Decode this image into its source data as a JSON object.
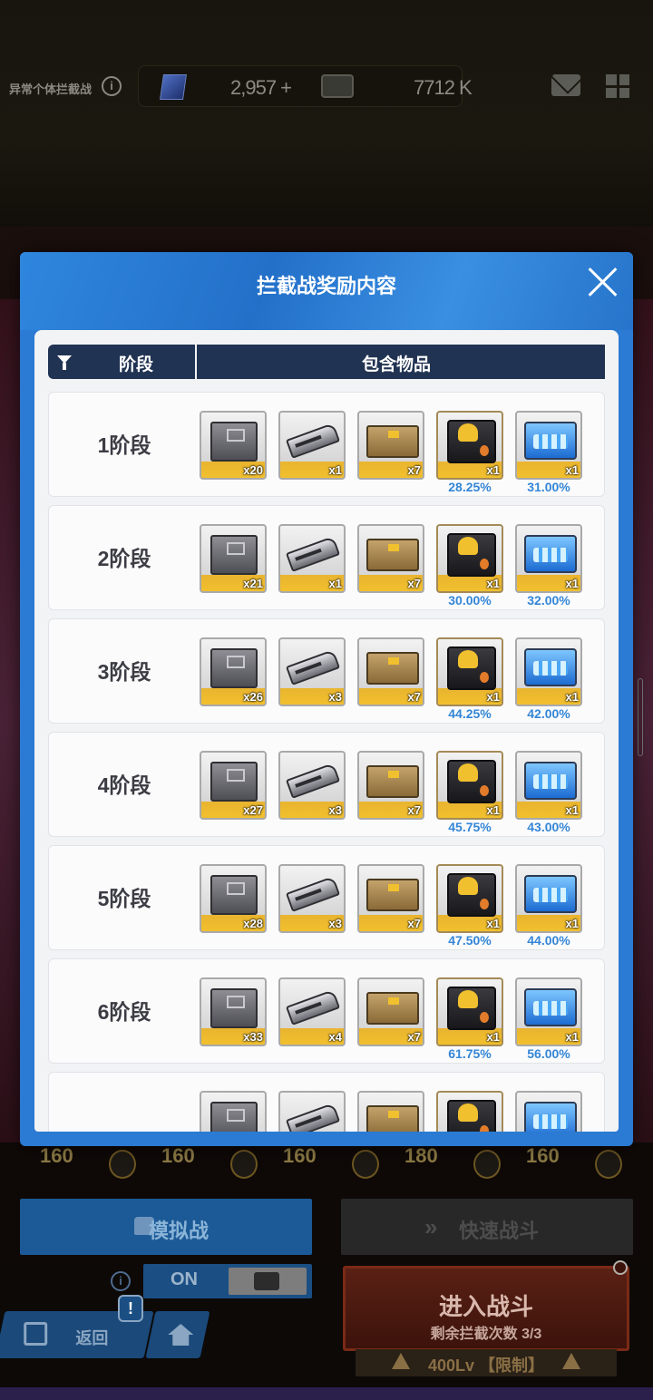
{
  "topbar": {
    "title": "异常个体拦截战",
    "info_icon": "info-icon",
    "currency1_value": "2,957 +",
    "currency2_value": "7712 K"
  },
  "modal": {
    "title": "拦截战奖励内容",
    "header_stage": "阶段",
    "header_items": "包含物品",
    "rows": [
      {
        "label": "1阶段",
        "counts": [
          "x20",
          "x1",
          "x7",
          "x1",
          "x1"
        ],
        "pct1": "28.25%",
        "pct2": "31.00%"
      },
      {
        "label": "2阶段",
        "counts": [
          "x21",
          "x1",
          "x7",
          "x1",
          "x1"
        ],
        "pct1": "30.00%",
        "pct2": "32.00%"
      },
      {
        "label": "3阶段",
        "counts": [
          "x26",
          "x3",
          "x7",
          "x1",
          "x1"
        ],
        "pct1": "44.25%",
        "pct2": "42.00%"
      },
      {
        "label": "4阶段",
        "counts": [
          "x27",
          "x3",
          "x7",
          "x1",
          "x1"
        ],
        "pct1": "45.75%",
        "pct2": "43.00%"
      },
      {
        "label": "5阶段",
        "counts": [
          "x28",
          "x3",
          "x7",
          "x1",
          "x1"
        ],
        "pct1": "47.50%",
        "pct2": "44.00%"
      },
      {
        "label": "6阶段",
        "counts": [
          "x33",
          "x4",
          "x7",
          "x1",
          "x1"
        ],
        "pct1": "61.75%",
        "pct2": "56.00%"
      }
    ]
  },
  "bottom": {
    "levels": [
      "160",
      "160",
      "160",
      "180",
      "160"
    ],
    "sim_battle": "模拟战",
    "fast_battle": "快速战斗",
    "toggle_label": "ON",
    "back_label": "返回",
    "alert": "!",
    "enter_battle": "进入战斗",
    "remaining": "剩余拦截次数 3/3",
    "level_limit": "400Lv 【限制】"
  }
}
